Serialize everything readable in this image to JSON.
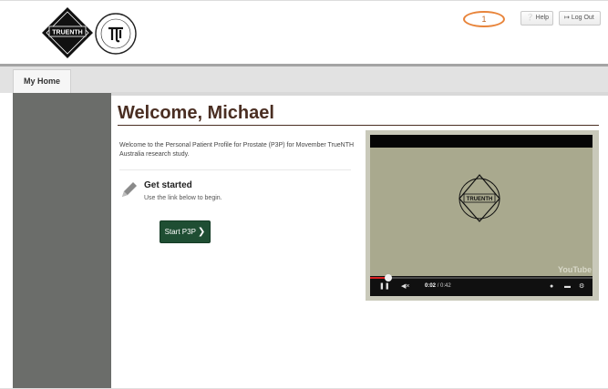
{
  "header": {
    "logo_text": "TRUENTH",
    "notification_count": "1",
    "help_label": "Help",
    "logout_label": "Log Out",
    "help_icon": "question-circle-icon",
    "logout_icon": "sign-out-icon"
  },
  "nav": {
    "tabs": [
      {
        "label": "My Home"
      }
    ]
  },
  "main": {
    "welcome_title": "Welcome, Michael",
    "intro_text": "Welcome to the Personal Patient Profile for Prostate (P3P) for Movember TrueNTH Australia research study.",
    "get_started": {
      "title": "Get started",
      "subtitle": "Use the link below to begin.",
      "button_label": "Start P3P",
      "icon": "pencil-icon"
    }
  },
  "video": {
    "logo_text": "TRUENTH",
    "time_current": "0:02",
    "time_total": "/ 0:42",
    "progress": 0.08,
    "brand": "YouTube"
  },
  "colors": {
    "title_brown": "#4a2e22",
    "start_button_green": "#1f4e33",
    "sidebar_gray": "#6b6d6a",
    "notification_orange": "#e8843a",
    "progress_red": "#d82020"
  }
}
